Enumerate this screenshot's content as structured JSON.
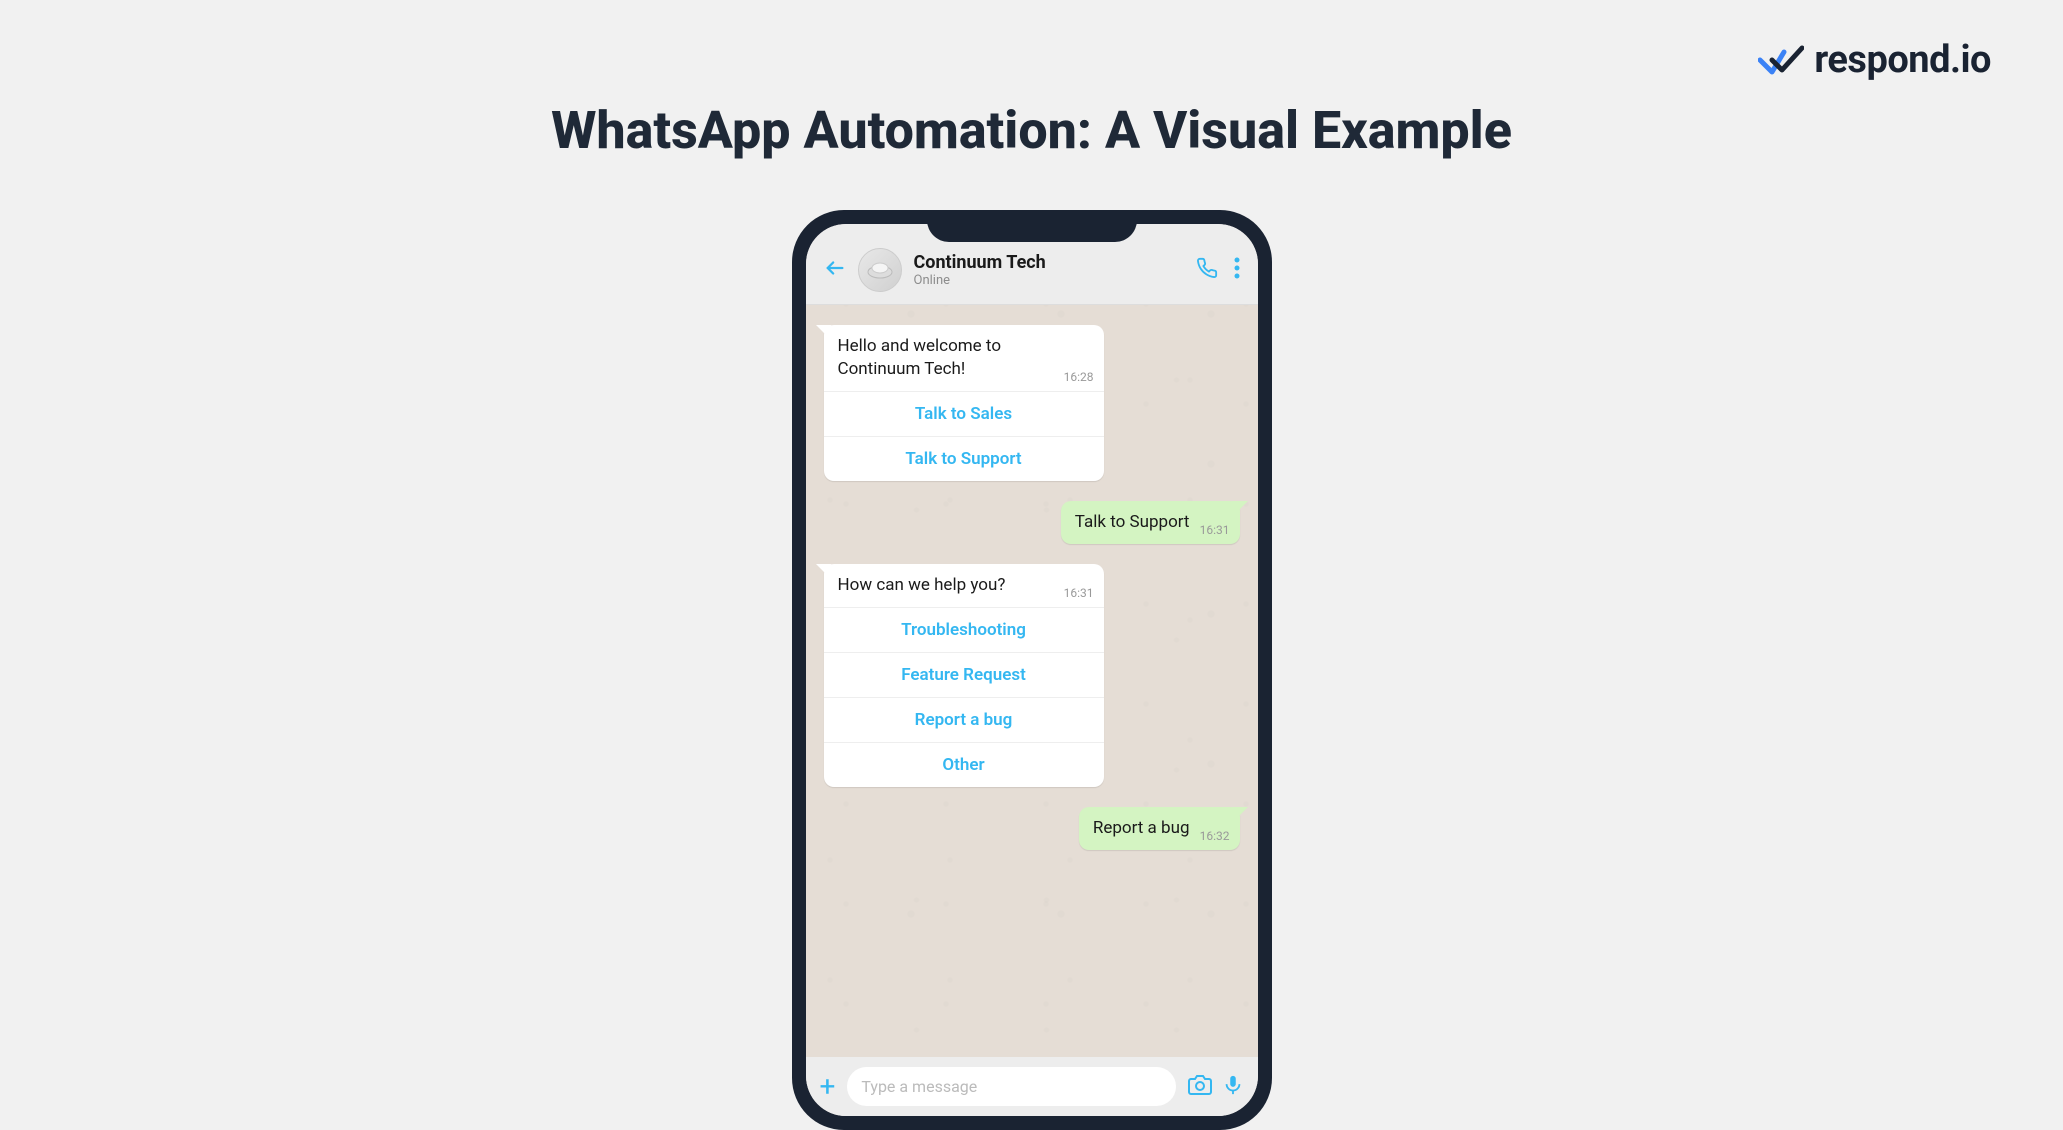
{
  "logo": {
    "text": "respond.io"
  },
  "title": "WhatsApp Automation: A Visual Example",
  "chat": {
    "contact": {
      "name": "Continuum Tech",
      "status": "Online"
    },
    "messages": [
      {
        "type": "in",
        "text": "Hello and welcome to Continuum Tech!",
        "time": "16:28",
        "buttons": [
          "Talk to Sales",
          "Talk to Support"
        ]
      },
      {
        "type": "out",
        "text": "Talk to Support",
        "time": "16:31"
      },
      {
        "type": "in",
        "text": "How can we help you?",
        "time": "16:31",
        "buttons": [
          "Troubleshooting",
          "Feature Request",
          "Report a bug",
          "Other"
        ]
      },
      {
        "type": "out",
        "text": "Report a bug",
        "time": "16:32"
      }
    ],
    "input_placeholder": "Type a message"
  }
}
